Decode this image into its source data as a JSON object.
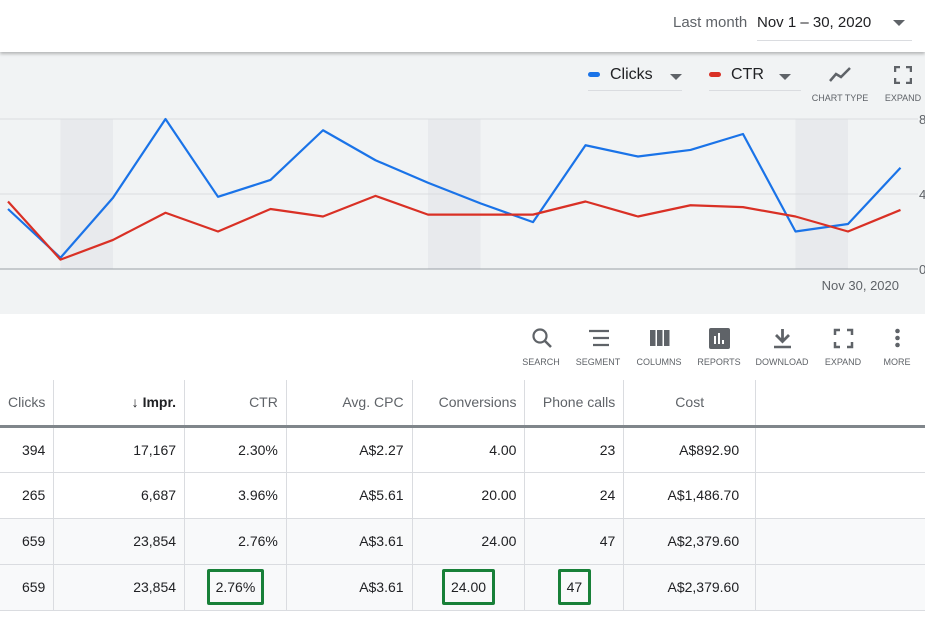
{
  "header": {
    "range_label": "Last month",
    "date_range": "Nov 1 – 30, 2020"
  },
  "chart_controls": {
    "metric1": "Clicks",
    "metric2": "CTR",
    "chart_type": "CHART TYPE",
    "expand": "EXPAND"
  },
  "colors": {
    "clicks": "#1a73e8",
    "ctr": "#d93025",
    "highlight": "#188038"
  },
  "chart_data": {
    "type": "line",
    "x_end_label": "Nov 30, 2020",
    "y_ticks": [
      "8",
      "4",
      "0"
    ],
    "ylim": [
      0,
      8
    ],
    "grid": true,
    "series": [
      {
        "name": "Clicks",
        "values": [
          3.2,
          0.6,
          3.8,
          8.0,
          3.85,
          4.75,
          7.4,
          5.8,
          4.6,
          3.5,
          2.5,
          6.6,
          6.0,
          6.35,
          7.2,
          2.0,
          2.4,
          5.4
        ]
      },
      {
        "name": "CTR",
        "values": [
          3.6,
          0.5,
          1.55,
          3.0,
          2.0,
          3.2,
          2.8,
          3.9,
          2.9,
          2.9,
          2.9,
          3.6,
          2.8,
          3.4,
          3.3,
          2.8,
          2.0,
          3.15
        ]
      }
    ]
  },
  "table_toolbar": [
    {
      "label": "SEARCH",
      "icon": "search-icon"
    },
    {
      "label": "SEGMENT",
      "icon": "segment-icon"
    },
    {
      "label": "COLUMNS",
      "icon": "columns-icon"
    },
    {
      "label": "REPORTS",
      "icon": "reports-icon"
    },
    {
      "label": "DOWNLOAD",
      "icon": "download-icon"
    },
    {
      "label": "EXPAND",
      "icon": "expand-icon"
    },
    {
      "label": "MORE",
      "icon": "more-vert-icon"
    }
  ],
  "table": {
    "columns": [
      "Clicks",
      "Impr.",
      "CTR",
      "Avg. CPC",
      "Conversions",
      "Phone calls",
      "Cost"
    ],
    "sort_column": "Impr.",
    "rows": [
      [
        "394",
        "17,167",
        "2.30%",
        "A$2.27",
        "4.00",
        "23",
        "A$892.90"
      ],
      [
        "265",
        "6,687",
        "3.96%",
        "A$5.61",
        "20.00",
        "24",
        "A$1,486.70"
      ],
      [
        "659",
        "23,854",
        "2.76%",
        "A$3.61",
        "24.00",
        "47",
        "A$2,379.60"
      ],
      [
        "659",
        "23,854",
        "2.76%",
        "A$3.61",
        "24.00",
        "47",
        "A$2,379.60"
      ]
    ]
  }
}
